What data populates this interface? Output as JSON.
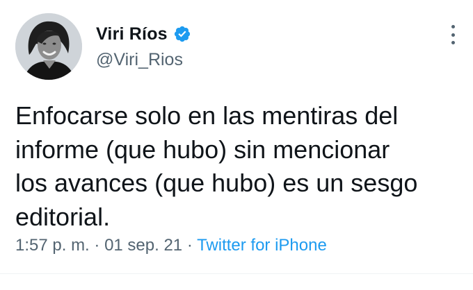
{
  "author": {
    "display_name": "Viri Ríos",
    "handle": "@Viri_Rios",
    "verified": true,
    "avatar": "profile-photo"
  },
  "tweet": {
    "text": "Enfocarse solo en las mentiras del\ninforme (que hubo) sin mencionar\nlos avances (que hubo) es un sesgo\neditorial.",
    "time": "1:57 p. m.",
    "separator1": " · ",
    "date": "01 sep. 21",
    "separator2": " · ",
    "source": "Twitter for iPhone"
  },
  "icons": {
    "verified": "verified-badge-icon",
    "more": "more-options-icon"
  },
  "colors": {
    "accent": "#1d9bf0",
    "secondary_text": "#536471",
    "primary_text": "#0f1419"
  }
}
